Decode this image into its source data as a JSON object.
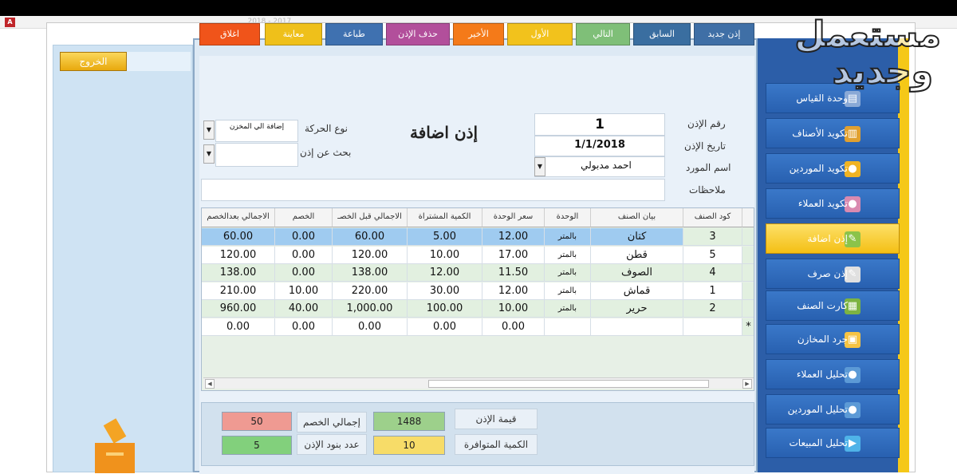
{
  "window": {
    "strip_title": "ـ ـ ـ ـ ـ ـ ـ ـ 2017 - 2018 ـ ـ ـ ـ ـ ـ ـ ـ ـ ـ ـ"
  },
  "watermark": {
    "line1": "مستعمل",
    "line2": "وجديد"
  },
  "left_panel": {
    "exit_label": "الخروج"
  },
  "toolbar": [
    {
      "label": "إذن جديد",
      "color": "#3f6fa6"
    },
    {
      "label": "السابق",
      "color": "#3a6ea0"
    },
    {
      "label": "التالي",
      "color": "#7fbf78"
    },
    {
      "label": "الأول",
      "color": "#f2c21c"
    },
    {
      "label": "الأخير",
      "color": "#f47a19"
    },
    {
      "label": "حذف الإذن",
      "color": "#b24f9b"
    },
    {
      "label": "طباعة",
      "color": "#3f71b0"
    },
    {
      "label": "معاينة",
      "color": "#efc01a"
    },
    {
      "label": "اغلاق",
      "color": "#f0541a"
    }
  ],
  "form": {
    "title": "إذن اضافة",
    "permit_no_label": "رقم الإذن",
    "permit_no": "1",
    "permit_date_label": "تاريخ الإذن",
    "permit_date": "1/1/2018",
    "supplier_label": "اسم المورد",
    "supplier": "احمد مدبولي",
    "notes_label": "ملاحظات",
    "notes": "",
    "movement_type_label": "نوع الحركة",
    "movement_type": "إضافة الي المخزن",
    "search_label": "بحث عن إذن",
    "search_value": ""
  },
  "grid": {
    "headers": [
      "كود الصنف",
      "بيان الصنف",
      "الوحدة",
      "سعر الوحدة",
      "الكمية المشتراة",
      "الاجمالي قبل الخصـ",
      "الخصم",
      "الاجمالي بعدالخصم"
    ],
    "rows": [
      [
        "3",
        "كتان",
        "بالمتر",
        "12.00",
        "5.00",
        "60.00",
        "0.00",
        "60.00"
      ],
      [
        "5",
        "قطن",
        "بالمتر",
        "17.00",
        "10.00",
        "120.00",
        "0.00",
        "120.00"
      ],
      [
        "4",
        "الصوف",
        "بالمتر",
        "11.50",
        "12.00",
        "138.00",
        "0.00",
        "138.00"
      ],
      [
        "1",
        "قماش",
        "بالمتر",
        "12.00",
        "30.00",
        "220.00",
        "10.00",
        "210.00"
      ],
      [
        "2",
        "حرير",
        "بالمتر",
        "10.00",
        "100.00",
        "1,000.00",
        "40.00",
        "960.00"
      ]
    ],
    "new_row": [
      "",
      "",
      "",
      "0.00",
      "0.00",
      "0.00",
      "0.00",
      "0.00"
    ],
    "new_row_marker": "*"
  },
  "summary": {
    "permit_value_label": "قيمة الإذن",
    "permit_value": "1488",
    "available_qty_label": "الكمية المتوافرة",
    "available_qty": "10",
    "total_discount_label": "إجمالي الخصم",
    "total_discount": "50",
    "items_count_label": "عدد بنود الإذن",
    "items_count": "5"
  },
  "sidebar": [
    {
      "label": "وحدة القياس",
      "icon": "ruler-icon"
    },
    {
      "label": "تكويد الأصناف",
      "icon": "barcode-icon"
    },
    {
      "label": "تكويد الموردين",
      "icon": "person-icon"
    },
    {
      "label": "تكويد العملاء",
      "icon": "people-icon"
    },
    {
      "label": "إذن اضافة",
      "icon": "document-add-icon",
      "active": true
    },
    {
      "label": "إذن صرف",
      "icon": "document-out-icon"
    },
    {
      "label": "كارت الصنف",
      "icon": "card-icon"
    },
    {
      "label": "جرد المخازن",
      "icon": "box-icon"
    },
    {
      "label": "تحليل العملاء",
      "icon": "person-chart-icon"
    },
    {
      "label": "تحليل الموردين",
      "icon": "person-chart-icon"
    },
    {
      "label": "تحليل المبيعات",
      "icon": "cart-icon"
    }
  ]
}
